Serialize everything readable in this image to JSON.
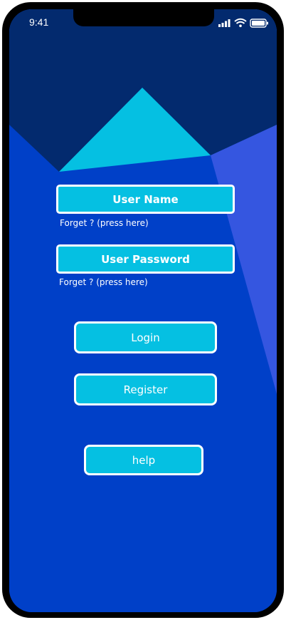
{
  "status_bar": {
    "time": "9:41",
    "icons": [
      "cellular-signal-icon",
      "wifi-icon",
      "battery-icon"
    ]
  },
  "login_form": {
    "username_label": "User Name",
    "username_forgot": "Forget ? (press here)",
    "password_label": "User Password",
    "password_forgot": "Forget ? (press here)"
  },
  "actions": {
    "login_label": "Login",
    "register_label": "Register",
    "help_label": "help"
  },
  "colors": {
    "background_top": "#032a6e",
    "background_main": "#0040c8",
    "diamond": "#05c0e2",
    "right_panel": "#3556e0",
    "frame": "#000000",
    "button_border": "#ffffff"
  }
}
